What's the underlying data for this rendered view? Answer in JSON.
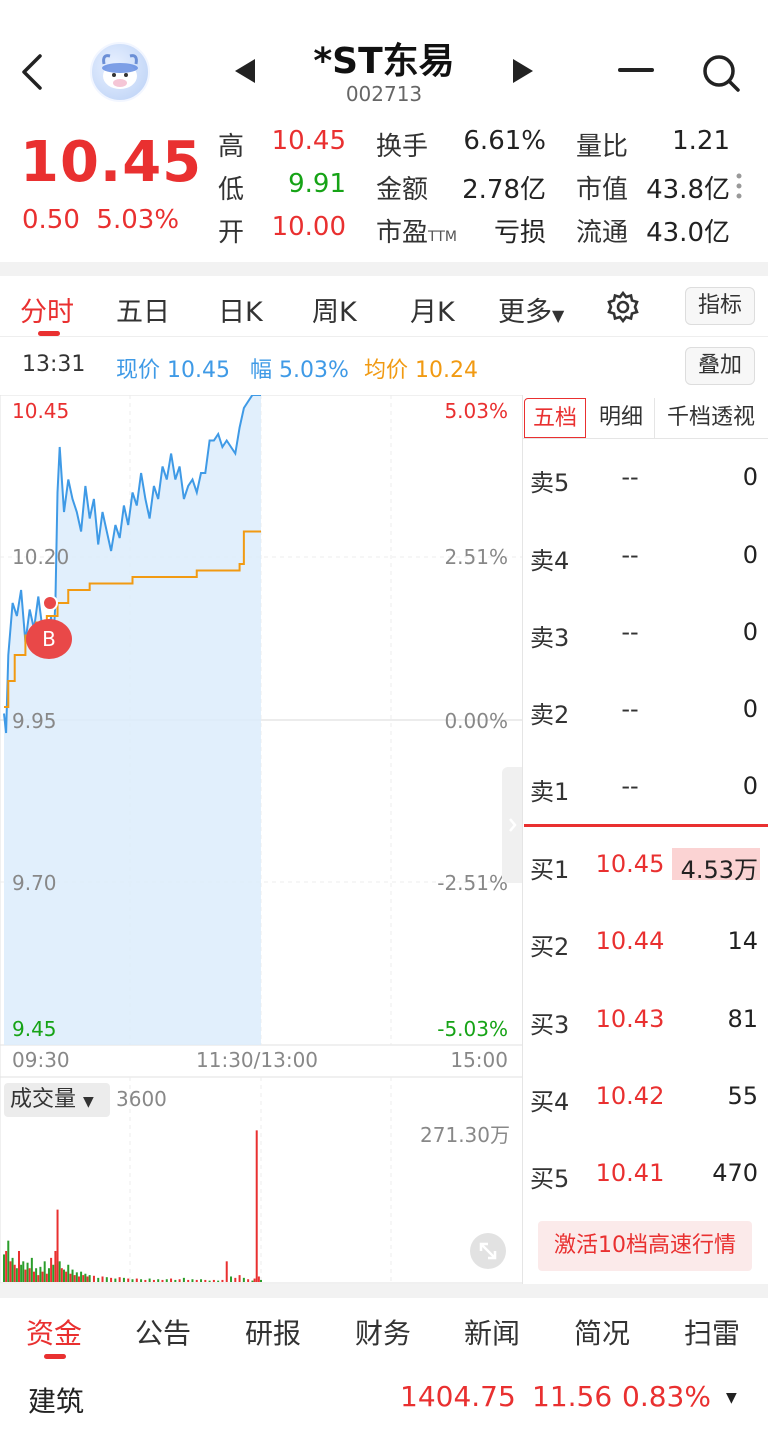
{
  "header": {
    "title": "*ST东易",
    "code": "002713"
  },
  "quote": {
    "price": "10.45",
    "change": "0.50",
    "change_pct": "5.03%",
    "rows": [
      [
        {
          "label": "高",
          "value": "10.45",
          "color": "red"
        },
        {
          "label": "换手",
          "value": "6.61%",
          "color": "dark"
        },
        {
          "label": "量比",
          "value": "1.21",
          "color": "dark"
        }
      ],
      [
        {
          "label": "低",
          "value": "9.91",
          "color": "green"
        },
        {
          "label": "金额",
          "value": "2.78亿",
          "color": "dark"
        },
        {
          "label": "市值",
          "value": "43.8亿",
          "color": "dark"
        }
      ],
      [
        {
          "label": "开",
          "value": "10.00",
          "color": "red"
        },
        {
          "label": "市盈",
          "label_sup": "TTM",
          "value": "亏损",
          "color": "dark"
        },
        {
          "label": "流通",
          "value": "43.0亿",
          "color": "dark"
        }
      ]
    ]
  },
  "tabs": {
    "items": [
      "分时",
      "五日",
      "日K",
      "周K",
      "月K",
      "更多"
    ],
    "indicator_label": "指标"
  },
  "info": {
    "time": "13:31",
    "price_text": "现价 10.45",
    "pct_text": "幅 5.03%",
    "avg_text": "均价 10.24",
    "overlay_label": "叠加"
  },
  "chart_axes": {
    "price_labels": [
      "10.45",
      "10.20",
      "9.95",
      "9.70",
      "9.45"
    ],
    "pct_labels": [
      "5.03%",
      "2.51%",
      "0.00%",
      "-2.51%",
      "-5.03%"
    ],
    "time_labels": [
      "09:30",
      "11:30/13:00",
      "15:00"
    ],
    "volume_label": "成交量",
    "volume_tick": "3600",
    "volume_max": "271.30万",
    "marker": "B"
  },
  "chart_data": {
    "type": "line",
    "ylim": [
      9.45,
      10.45
    ],
    "x_session_minutes": 240,
    "series": [
      {
        "name": "现价",
        "color": "#3f9ae6",
        "points": [
          [
            0,
            9.96
          ],
          [
            1,
            9.93
          ],
          [
            2,
            10.05
          ],
          [
            4,
            10.13
          ],
          [
            6,
            10.11
          ],
          [
            8,
            10.15
          ],
          [
            10,
            10.07
          ],
          [
            12,
            10.12
          ],
          [
            14,
            10.09
          ],
          [
            16,
            10.14
          ],
          [
            18,
            10.09
          ],
          [
            20,
            10.05
          ],
          [
            22,
            10.11
          ],
          [
            23,
            10.07
          ],
          [
            24,
            10.13
          ],
          [
            25,
            10.3
          ],
          [
            26,
            10.37
          ],
          [
            28,
            10.27
          ],
          [
            30,
            10.32
          ],
          [
            32,
            10.29
          ],
          [
            34,
            10.27
          ],
          [
            36,
            10.24
          ],
          [
            38,
            10.31
          ],
          [
            40,
            10.26
          ],
          [
            42,
            10.29
          ],
          [
            44,
            10.22
          ],
          [
            46,
            10.27
          ],
          [
            48,
            10.24
          ],
          [
            50,
            10.21
          ],
          [
            52,
            10.25
          ],
          [
            54,
            10.23
          ],
          [
            56,
            10.28
          ],
          [
            58,
            10.25
          ],
          [
            60,
            10.3
          ],
          [
            62,
            10.28
          ],
          [
            64,
            10.33
          ],
          [
            66,
            10.29
          ],
          [
            68,
            10.26
          ],
          [
            70,
            10.31
          ],
          [
            72,
            10.29
          ],
          [
            74,
            10.34
          ],
          [
            76,
            10.32
          ],
          [
            78,
            10.36
          ],
          [
            80,
            10.32
          ],
          [
            82,
            10.34
          ],
          [
            84,
            10.29
          ],
          [
            86,
            10.31
          ],
          [
            88,
            10.32
          ],
          [
            90,
            10.3
          ],
          [
            92,
            10.33
          ],
          [
            94,
            10.33
          ],
          [
            96,
            10.38
          ],
          [
            98,
            10.38
          ],
          [
            100,
            10.39
          ],
          [
            102,
            10.37
          ],
          [
            104,
            10.38
          ],
          [
            106,
            10.37
          ],
          [
            108,
            10.36
          ],
          [
            110,
            10.4
          ],
          [
            112,
            10.43
          ],
          [
            114,
            10.44
          ],
          [
            116,
            10.45
          ],
          [
            118,
            10.45
          ],
          [
            120,
            10.45
          ]
        ]
      },
      {
        "name": "均价",
        "color": "#f19a12",
        "points": [
          [
            0,
            9.97
          ],
          [
            2,
            10.01
          ],
          [
            5,
            10.05
          ],
          [
            10,
            10.08
          ],
          [
            15,
            10.1
          ],
          [
            20,
            10.11
          ],
          [
            25,
            10.13
          ],
          [
            30,
            10.15
          ],
          [
            40,
            10.16
          ],
          [
            50,
            10.16
          ],
          [
            60,
            10.17
          ],
          [
            70,
            10.17
          ],
          [
            80,
            10.17
          ],
          [
            90,
            10.18
          ],
          [
            100,
            10.18
          ],
          [
            110,
            10.19
          ],
          [
            112,
            10.24
          ],
          [
            120,
            10.24
          ]
        ]
      }
    ],
    "volume": {
      "ylim": [
        0,
        271.3
      ],
      "bars": [
        [
          0,
          40,
          "g"
        ],
        [
          1,
          45,
          "r"
        ],
        [
          2,
          60,
          "g"
        ],
        [
          3,
          30,
          "r"
        ],
        [
          4,
          35,
          "g"
        ],
        [
          5,
          25,
          "r"
        ],
        [
          6,
          20,
          "g"
        ],
        [
          7,
          45,
          "r"
        ],
        [
          8,
          25,
          "g"
        ],
        [
          9,
          30,
          "g"
        ],
        [
          10,
          18,
          "r"
        ],
        [
          11,
          28,
          "g"
        ],
        [
          12,
          20,
          "r"
        ],
        [
          13,
          35,
          "g"
        ],
        [
          14,
          15,
          "r"
        ],
        [
          15,
          20,
          "g"
        ],
        [
          16,
          10,
          "r"
        ],
        [
          17,
          22,
          "g"
        ],
        [
          18,
          15,
          "r"
        ],
        [
          19,
          30,
          "g"
        ],
        [
          20,
          12,
          "r"
        ],
        [
          21,
          20,
          "g"
        ],
        [
          22,
          35,
          "r"
        ],
        [
          23,
          25,
          "g"
        ],
        [
          24,
          45,
          "r"
        ],
        [
          25,
          105,
          "r"
        ],
        [
          26,
          30,
          "g"
        ],
        [
          27,
          20,
          "r"
        ],
        [
          28,
          18,
          "g"
        ],
        [
          29,
          15,
          "r"
        ],
        [
          30,
          25,
          "g"
        ],
        [
          31,
          12,
          "r"
        ],
        [
          32,
          18,
          "g"
        ],
        [
          33,
          10,
          "r"
        ],
        [
          34,
          14,
          "g"
        ],
        [
          35,
          8,
          "r"
        ],
        [
          36,
          15,
          "g"
        ],
        [
          37,
          10,
          "r"
        ],
        [
          38,
          12,
          "g"
        ],
        [
          39,
          8,
          "r"
        ],
        [
          40,
          10,
          "g"
        ],
        [
          42,
          9,
          "r"
        ],
        [
          44,
          6,
          "g"
        ],
        [
          46,
          8,
          "r"
        ],
        [
          48,
          7,
          "g"
        ],
        [
          50,
          6,
          "r"
        ],
        [
          52,
          5,
          "g"
        ],
        [
          54,
          7,
          "r"
        ],
        [
          56,
          6,
          "g"
        ],
        [
          58,
          5,
          "r"
        ],
        [
          60,
          4,
          "g"
        ],
        [
          62,
          5,
          "r"
        ],
        [
          64,
          4,
          "g"
        ],
        [
          66,
          3,
          "r"
        ],
        [
          68,
          5,
          "g"
        ],
        [
          70,
          3,
          "r"
        ],
        [
          72,
          4,
          "g"
        ],
        [
          74,
          3,
          "r"
        ],
        [
          76,
          4,
          "g"
        ],
        [
          78,
          5,
          "r"
        ],
        [
          80,
          3,
          "g"
        ],
        [
          82,
          4,
          "r"
        ],
        [
          84,
          6,
          "g"
        ],
        [
          86,
          3,
          "r"
        ],
        [
          88,
          4,
          "g"
        ],
        [
          90,
          3,
          "r"
        ],
        [
          92,
          4,
          "g"
        ],
        [
          94,
          3,
          "r"
        ],
        [
          96,
          2,
          "g"
        ],
        [
          98,
          3,
          "r"
        ],
        [
          100,
          2,
          "g"
        ],
        [
          102,
          3,
          "r"
        ],
        [
          104,
          30,
          "r"
        ],
        [
          106,
          8,
          "g"
        ],
        [
          108,
          6,
          "r"
        ],
        [
          110,
          10,
          "r"
        ],
        [
          112,
          6,
          "g"
        ],
        [
          114,
          4,
          "r"
        ],
        [
          116,
          2,
          "g"
        ],
        [
          117,
          5,
          "r"
        ],
        [
          118,
          220,
          "r"
        ],
        [
          119,
          8,
          "r"
        ],
        [
          120,
          3,
          "g"
        ]
      ]
    }
  },
  "order_book": {
    "tabs": [
      "五档",
      "明细",
      "千档透视"
    ],
    "asks": [
      {
        "label": "卖5",
        "price": "--",
        "vol": "0"
      },
      {
        "label": "卖4",
        "price": "--",
        "vol": "0"
      },
      {
        "label": "卖3",
        "price": "--",
        "vol": "0"
      },
      {
        "label": "卖2",
        "price": "--",
        "vol": "0"
      },
      {
        "label": "卖1",
        "price": "--",
        "vol": "0"
      }
    ],
    "bids": [
      {
        "label": "买1",
        "price": "10.45",
        "vol": "4.53万"
      },
      {
        "label": "买2",
        "price": "10.44",
        "vol": "14"
      },
      {
        "label": "买3",
        "price": "10.43",
        "vol": "81"
      },
      {
        "label": "买4",
        "price": "10.42",
        "vol": "55"
      },
      {
        "label": "买5",
        "price": "10.41",
        "vol": "470"
      }
    ],
    "activate_label": "激活10档高速行情"
  },
  "bottom_tabs": [
    "资金",
    "公告",
    "研报",
    "财务",
    "新闻",
    "简况",
    "扫雷"
  ],
  "sector": {
    "name": "建筑",
    "index": "1404.75",
    "change": "11.56",
    "pct": "0.83%"
  }
}
